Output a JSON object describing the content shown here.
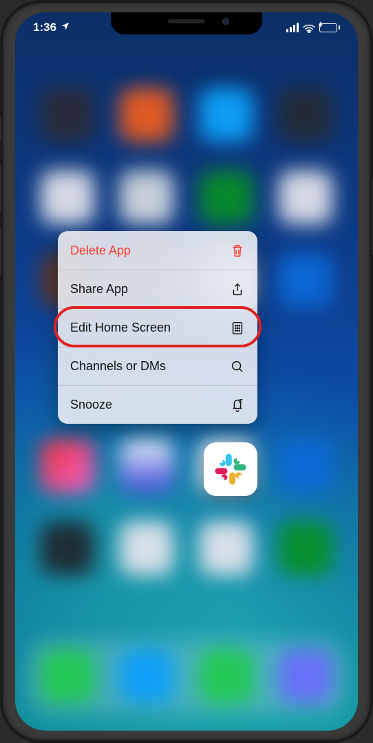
{
  "statusbar": {
    "time": "1:36",
    "battery_charging": true
  },
  "context_menu": {
    "items": [
      {
        "label": "Delete App",
        "icon": "trash-icon",
        "destructive": true
      },
      {
        "label": "Share App",
        "icon": "share-icon"
      },
      {
        "label": "Edit Home Screen",
        "icon": "apps-icon",
        "highlighted": true
      },
      {
        "label": "Channels or DMs",
        "icon": "search-icon"
      },
      {
        "label": "Snooze",
        "icon": "bell-snooze-icon"
      }
    ]
  },
  "app": {
    "name": "Slack"
  },
  "annotation": {
    "highlight_target": "edit-home-screen-item",
    "color": "#e0221f"
  }
}
